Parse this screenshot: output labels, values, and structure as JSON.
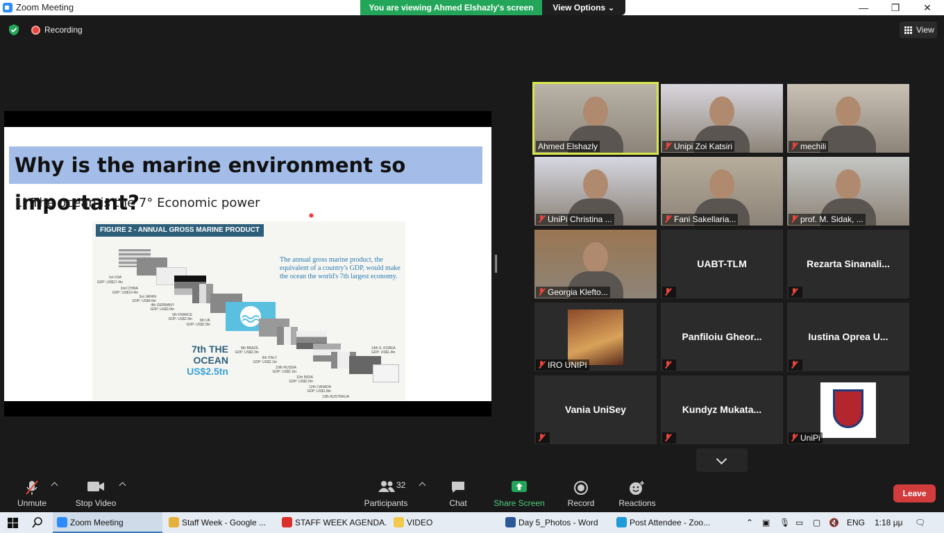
{
  "window": {
    "title": "Zoom Meeting",
    "viewing_banner": "You are viewing Ahmed Elshazly's screen",
    "view_options": "View Options",
    "minimize": "—",
    "maximize": "❐",
    "close": "✕"
  },
  "topbar": {
    "recording": "Recording",
    "view": "View"
  },
  "slide": {
    "title": "Why is the marine environment so important?",
    "point": "1) The ocean is the 7° Economic power",
    "figure_title": "FIGURE 2 - ANNUAL GROSS MARINE PRODUCT",
    "figure_text": "The annual gross marine product, the equivalent of a country's GDP, would make the ocean the world's 7th largest economy.",
    "ocean_rank": "7th THE OCEAN",
    "ocean_value": "US$2.5tn",
    "ranks": [
      {
        "label": "1st USA",
        "gdp": "GDP: US$17.4tn"
      },
      {
        "label": "2nd CHINA",
        "gdp": "GDP: US$10.4tn"
      },
      {
        "label": "3rd JAPAN",
        "gdp": "GDP: US$4.6tn"
      },
      {
        "label": "4th GERMANY",
        "gdp": "GDP: US$3.9tn"
      },
      {
        "label": "5th FRANCE",
        "gdp": "GDP: US$2.9tn"
      },
      {
        "label": "6th UK",
        "gdp": "GDP: US$2.9tn"
      },
      {
        "label": "8th BRAZIL",
        "gdp": "GDP: US$2.3tn"
      },
      {
        "label": "9th ITALY",
        "gdp": "GDP: US$2.1tn"
      },
      {
        "label": "10th RUSSIA",
        "gdp": "GDP: US$2.1tn"
      },
      {
        "label": "11th INDIA",
        "gdp": "GDP: US$2.0tn"
      },
      {
        "label": "12th CANADA",
        "gdp": "GDP: US$1.8tn"
      },
      {
        "label": "13th AUSTRALIA",
        "gdp": ""
      },
      {
        "label": "14th S. KOREA",
        "gdp": "GDP: US$1.4tn"
      }
    ]
  },
  "participants": [
    {
      "name": "Ahmed Elshazly",
      "video": true,
      "muted": false,
      "active": true,
      "bg": "#b9b4a8"
    },
    {
      "name": "Unipi Zoi Katsiri",
      "video": true,
      "muted": true,
      "bg": "#d9d6de"
    },
    {
      "name": "mechili",
      "video": true,
      "muted": true,
      "bg": "#c8c1b4"
    },
    {
      "name": "UniPi Christina ...",
      "video": true,
      "muted": true,
      "bg": "#d6d7e2"
    },
    {
      "name": "Fani Sakellaria...",
      "video": true,
      "muted": true,
      "bg": "#b7ad9c"
    },
    {
      "name": "prof. M. Sidak, ...",
      "video": true,
      "muted": true,
      "bg": "#c5c6c4"
    },
    {
      "name": "Georgia Klefto...",
      "video": true,
      "muted": true,
      "bg": "#9a7652"
    },
    {
      "name": "UABT-TLM",
      "video": false,
      "muted": true
    },
    {
      "name": "Rezarta  Sinanali...",
      "video": false,
      "muted": true
    },
    {
      "name": "IRO UNIPI",
      "video": false,
      "muted": true,
      "photo": true
    },
    {
      "name": "Panfiloiu  Gheor...",
      "video": false,
      "muted": true
    },
    {
      "name": "Iustina Oprea  U...",
      "video": false,
      "muted": true
    },
    {
      "name": "Vania UniSey",
      "video": false,
      "muted": true
    },
    {
      "name": "Kundyz  Mukata...",
      "video": false,
      "muted": true
    },
    {
      "name": "UniPi",
      "video": false,
      "muted": true,
      "logo": true
    }
  ],
  "toolbar": {
    "unmute": "Unmute",
    "stop_video": "Stop Video",
    "participants": "Participants",
    "participants_count": "32",
    "chat": "Chat",
    "share_screen": "Share Screen",
    "record": "Record",
    "reactions": "Reactions",
    "leave": "Leave"
  },
  "taskbar": {
    "apps": [
      {
        "label": "Zoom Meeting",
        "color": "#2d8cff",
        "active": true
      },
      {
        "label": "Staff Week - Google ...",
        "color": "#e5b13a"
      },
      {
        "label": "STAFF WEEK AGENDA...",
        "color": "#d9302b"
      },
      {
        "label": "VIDEO",
        "color": "#f2c94c"
      },
      {
        "label": "Day 5_Photos - Word",
        "color": "#2b5797"
      },
      {
        "label": "Post Attendee - Zoo...",
        "color": "#1f9bd6"
      }
    ],
    "lang": "ENG",
    "time": "1:18 μμ"
  },
  "colors": {
    "green_banner": "#23a65a",
    "leave_red": "#d23c3c",
    "active_speaker": "#d8e84c",
    "share_green": "#23a65a"
  }
}
